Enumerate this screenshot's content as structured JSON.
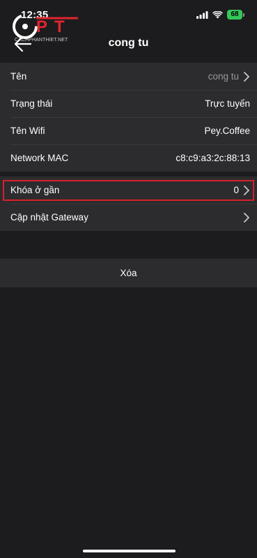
{
  "status_bar": {
    "time": "12:35",
    "battery": "68"
  },
  "watermark": {
    "text": "CACHPHANTHIET.NET",
    "brand": "CPT"
  },
  "nav": {
    "title": "cong tu"
  },
  "info_rows": [
    {
      "label": "Tên",
      "value": "cong tu"
    },
    {
      "label": "Trạng thái",
      "value": "Trực tuyến"
    },
    {
      "label": "Tên Wifi",
      "value": "Pey.Coffee"
    },
    {
      "label": "Network MAC",
      "value": "c8:c9:a3:2c:88:13"
    }
  ],
  "action_rows": [
    {
      "label": "Khóa ở gần",
      "value": "0"
    },
    {
      "label": "Cập nhật Gateway",
      "value": ""
    }
  ],
  "delete_label": "Xóa",
  "colors": {
    "background": "#1c1c1e",
    "cell": "#2c2c2e",
    "highlight": "#d9202a",
    "battery": "#34c759"
  }
}
